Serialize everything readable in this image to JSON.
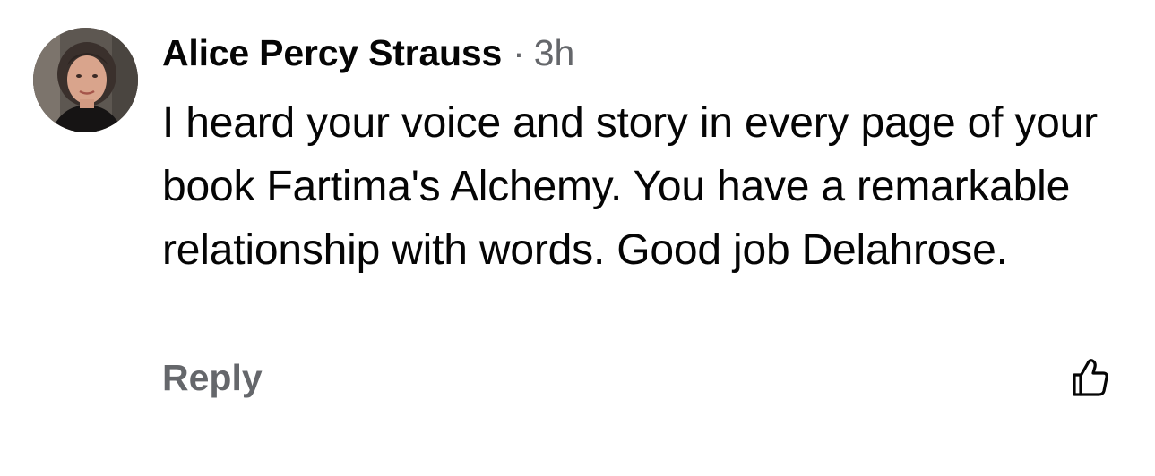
{
  "comment": {
    "author": "Alice Percy Strauss",
    "separator": "·",
    "time": "3h",
    "text": "I heard your voice and story in every page of your book Fartima's Alchemy. You have a remarkable relationship with words. Good job Delahrose.",
    "reply_label": "Reply",
    "like_icon": "thumbs-up-outline-icon",
    "avatar_icon": "profile-photo"
  },
  "colors": {
    "text_primary": "#050505",
    "text_secondary": "#65676b",
    "background": "#ffffff"
  }
}
